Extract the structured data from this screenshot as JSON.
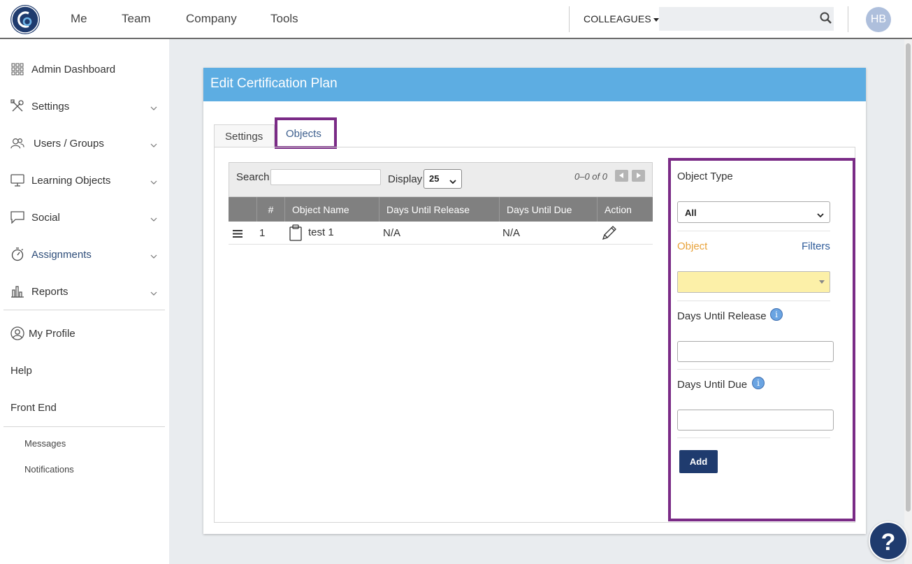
{
  "topnav": {
    "items": [
      "Me",
      "Team",
      "Company",
      "Tools"
    ],
    "colleagues_label": "COLLEAGUES",
    "avatar_initials": "HB"
  },
  "sidebar": {
    "items": [
      {
        "label": "Admin Dashboard",
        "icon": "grid-icon"
      },
      {
        "label": "Settings",
        "icon": "tools-icon"
      },
      {
        "label": "Users / Groups",
        "icon": "users-icon"
      },
      {
        "label": "Learning Objects",
        "icon": "monitor-icon"
      },
      {
        "label": "Social",
        "icon": "chat-icon"
      },
      {
        "label": "Assignments",
        "icon": "stopwatch-icon"
      },
      {
        "label": "Reports",
        "icon": "bar-chart-icon"
      }
    ],
    "my_profile": "My Profile",
    "help": "Help",
    "front_end": "Front End",
    "messages": "Messages",
    "notifications": "Notifications"
  },
  "panel": {
    "title": "Edit Certification Plan",
    "tabs": [
      "Settings",
      "Objects"
    ],
    "active_tab": "Objects"
  },
  "table": {
    "search_label": "Search",
    "display_label": "Display",
    "display_value": "25",
    "pager_text": "0–0 of 0",
    "columns": [
      "#",
      "Object Name",
      "Days Until Release",
      "Days Until Due",
      "Action"
    ],
    "rows": [
      {
        "num": "1",
        "name": "test 1",
        "release": "N/A",
        "due": "N/A"
      }
    ]
  },
  "filter": {
    "object_type_label": "Object Type",
    "object_type_value": "All",
    "object_label": "Object",
    "filters_link": "Filters",
    "days_release_label": "Days Until Release",
    "days_due_label": "Days Until Due",
    "info_glyph": "i",
    "add_button": "Add",
    "colors": {
      "object_label": "#e8a23a",
      "object_select_bg": "#fcf0a8",
      "add_button_bg": "#1f3b6e"
    }
  },
  "help_button": "?",
  "colors": {
    "header_bg": "#5dade2",
    "highlight_border": "#7a2b86",
    "brand_navy": "#1f3b6e"
  }
}
